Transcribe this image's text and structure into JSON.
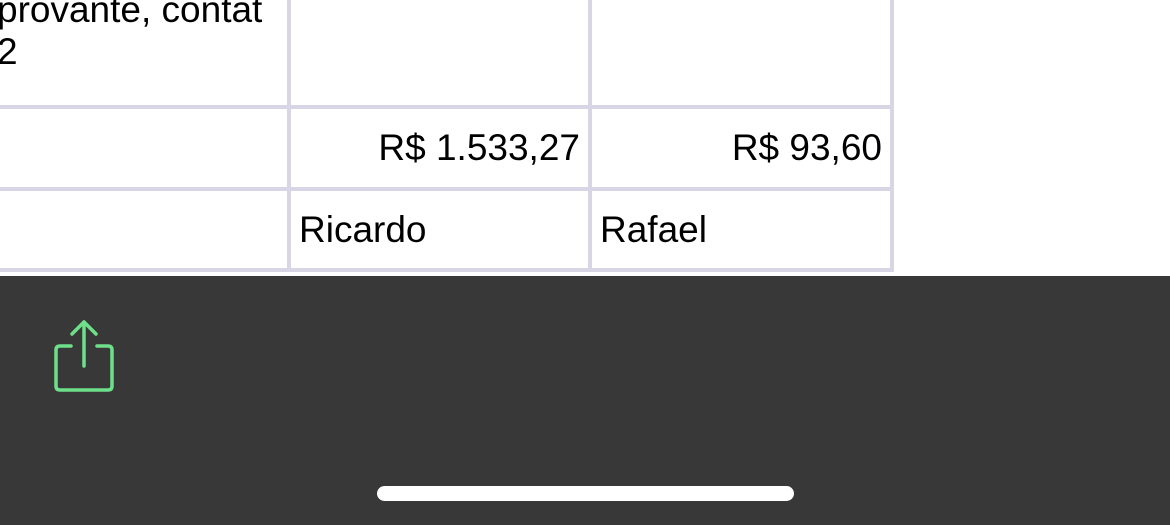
{
  "table": {
    "rows": [
      {
        "cells": [
          "provante, contat\n2",
          "",
          ""
        ]
      },
      {
        "cells": [
          "",
          "R$ 1.533,27",
          "R$ 93,60"
        ]
      },
      {
        "cells": [
          "",
          "Ricardo",
          "Rafael"
        ]
      }
    ]
  },
  "toolbar": {
    "share_icon": "share-icon",
    "icon_color": "#6EE08A",
    "background": "#383838"
  },
  "home_indicator": {
    "color": "#FFFFFF"
  }
}
